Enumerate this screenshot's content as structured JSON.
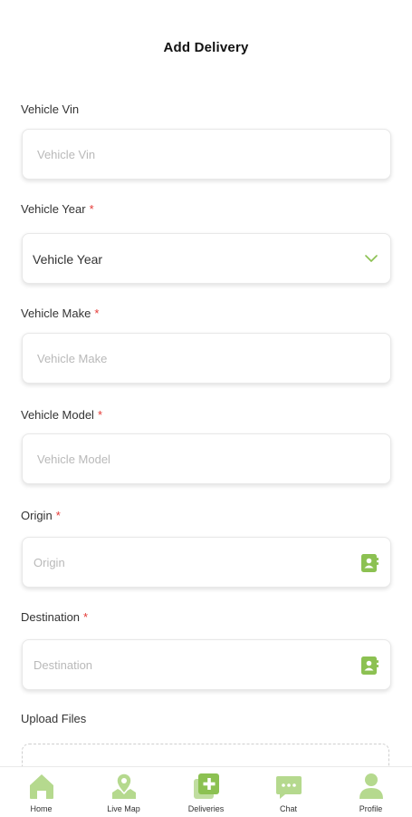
{
  "header": {
    "title": "Add Delivery"
  },
  "form": {
    "vin": {
      "label": "Vehicle Vin",
      "placeholder": "Vehicle Vin"
    },
    "year": {
      "label": "Vehicle Year",
      "required_mark": "*",
      "value": "Vehicle Year"
    },
    "make": {
      "label": "Vehicle Make",
      "required_mark": "*",
      "placeholder": "Vehicle Make"
    },
    "model": {
      "label": "Vehicle Model",
      "required_mark": "*",
      "placeholder": "Vehicle Model"
    },
    "origin": {
      "label": "Origin",
      "required_mark": "*",
      "placeholder": "Origin"
    },
    "destination": {
      "label": "Destination",
      "required_mark": "*",
      "placeholder": "Destination"
    },
    "upload": {
      "label": "Upload Files"
    }
  },
  "tabbar": {
    "items": [
      {
        "label": "Home",
        "icon": "home-icon"
      },
      {
        "label": "Live Map",
        "icon": "map-pin-icon"
      },
      {
        "label": "Deliveries",
        "icon": "add-delivery-icon"
      },
      {
        "label": "Chat",
        "icon": "chat-icon"
      },
      {
        "label": "Profile",
        "icon": "profile-icon"
      }
    ]
  },
  "colors": {
    "accent": "#8cc152",
    "accent_light": "#b5d98e",
    "required": "#e53935",
    "placeholder": "#b9b9b9"
  }
}
